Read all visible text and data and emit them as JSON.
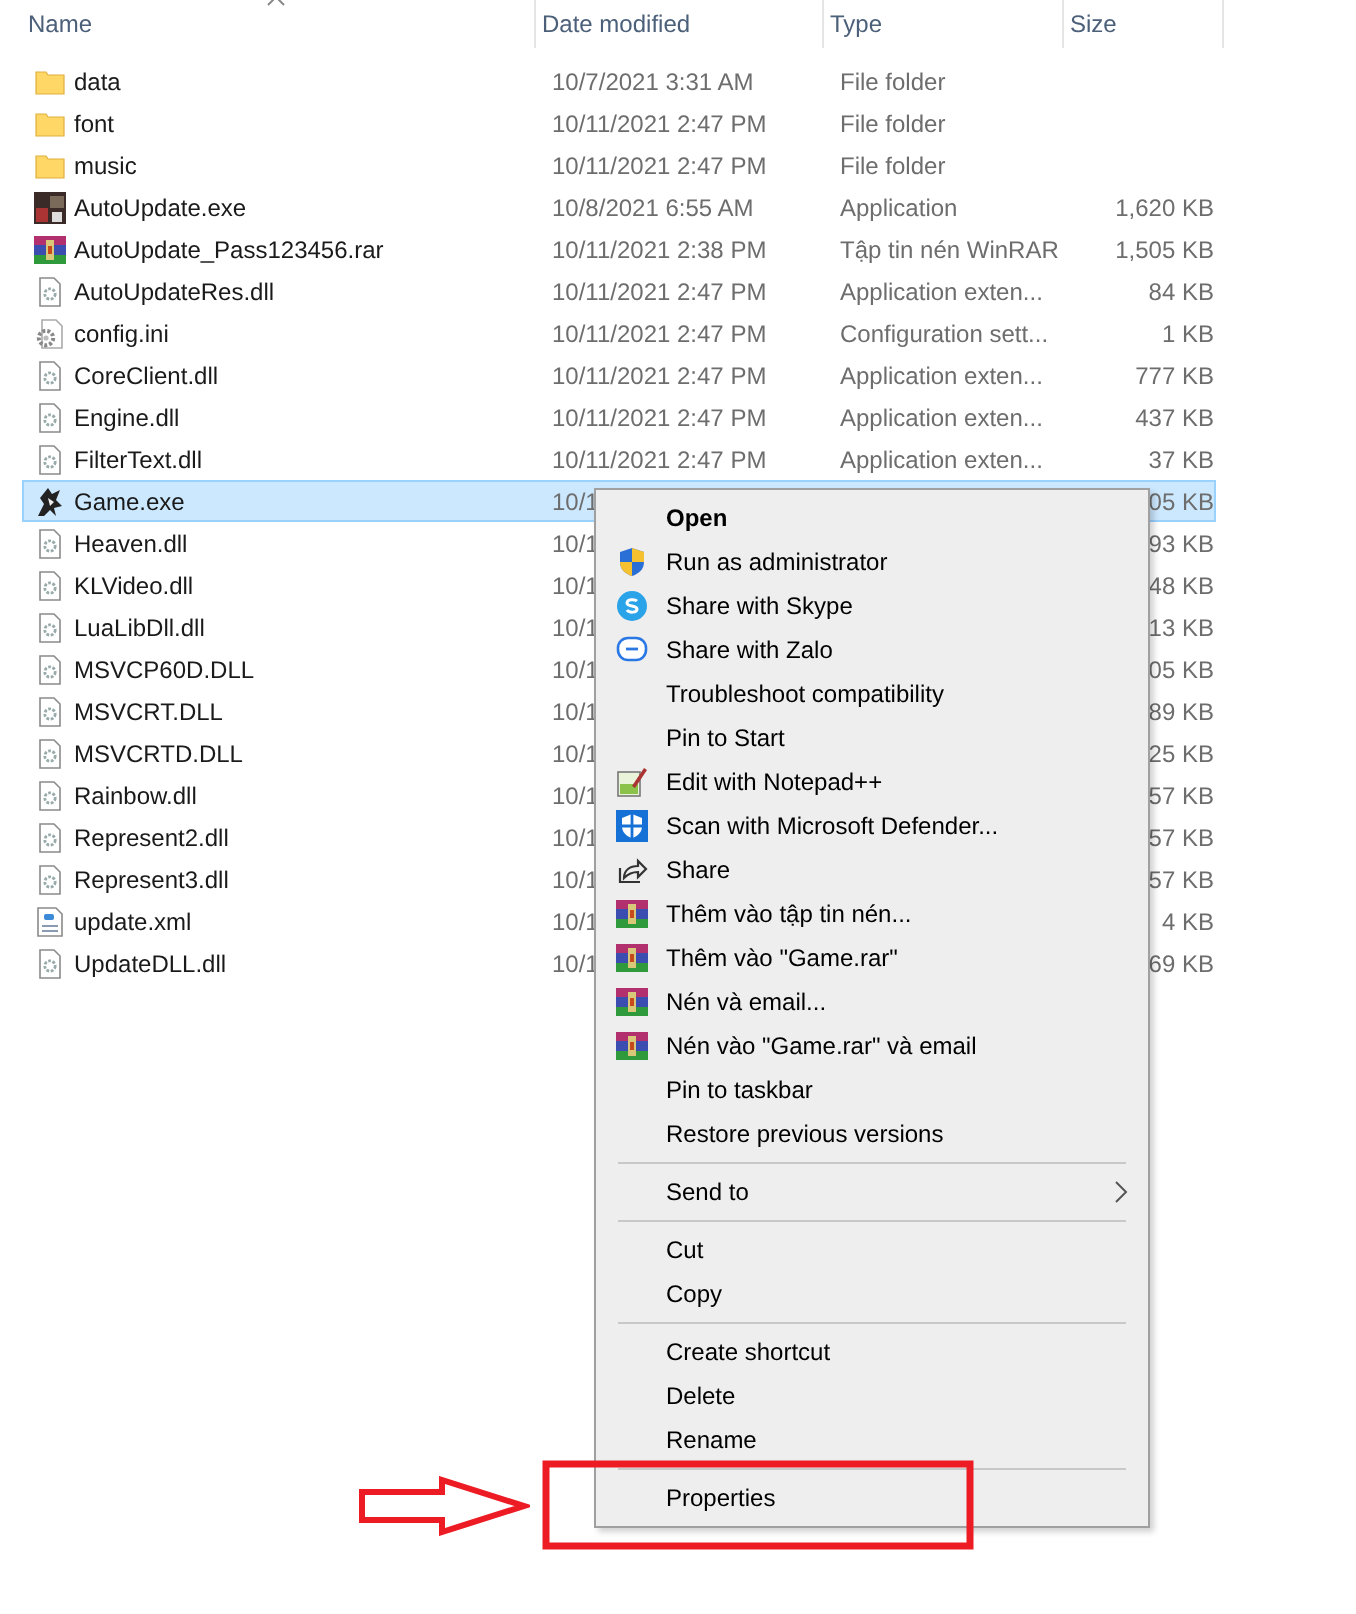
{
  "columns": [
    {
      "label": "Name",
      "sorted": true
    },
    {
      "label": "Date modified",
      "sorted": false
    },
    {
      "label": "Type",
      "sorted": false
    },
    {
      "label": "Size",
      "sorted": false
    }
  ],
  "files": [
    {
      "name": "data",
      "kind": "folder",
      "date": "10/7/2021 3:31 AM",
      "type": "File folder",
      "selected": false
    },
    {
      "name": "font",
      "kind": "folder",
      "date": "10/11/2021 2:47 PM",
      "type": "File folder",
      "selected": false
    },
    {
      "name": "music",
      "kind": "folder",
      "date": "10/11/2021 2:47 PM",
      "type": "File folder",
      "selected": false
    },
    {
      "name": "AutoUpdate.exe",
      "kind": "app",
      "date": "10/8/2021 6:55 AM",
      "type": "Application",
      "size": "1,620 KB",
      "selected": false
    },
    {
      "name": "AutoUpdate_Pass123456.rar",
      "kind": "archive",
      "date": "10/11/2021 2:38 PM",
      "type": "Tập tin nén WinRAR",
      "size": "1,505 KB",
      "selected": false
    },
    {
      "name": "AutoUpdateRes.dll",
      "kind": "dll",
      "date": "10/11/2021 2:47 PM",
      "type": "Application exten...",
      "size": "84 KB",
      "selected": false
    },
    {
      "name": "config.ini",
      "kind": "config",
      "date": "10/11/2021 2:47 PM",
      "type": "Configuration sett...",
      "size": "1 KB",
      "selected": false
    },
    {
      "name": "CoreClient.dll",
      "kind": "dll",
      "date": "10/11/2021 2:47 PM",
      "type": "Application exten...",
      "size": "777 KB",
      "selected": false
    },
    {
      "name": "Engine.dll",
      "kind": "dll",
      "date": "10/11/2021 2:47 PM",
      "type": "Application exten...",
      "size": "437 KB",
      "selected": false
    },
    {
      "name": "FilterText.dll",
      "kind": "dll",
      "date": "10/11/2021 2:47 PM",
      "type": "Application exten...",
      "size": "37 KB",
      "selected": false
    },
    {
      "name": "Game.exe",
      "kind": "game",
      "date": "10/1",
      "size": "05 KB",
      "selected": true
    },
    {
      "name": "Heaven.dll",
      "kind": "dll",
      "date": "10/1",
      "size": "93 KB",
      "selected": false
    },
    {
      "name": "KLVideo.dll",
      "kind": "dll",
      "date": "10/1",
      "size": "48 KB",
      "selected": false
    },
    {
      "name": "LuaLibDll.dll",
      "kind": "dll",
      "date": "10/1",
      "size": "13 KB",
      "selected": false
    },
    {
      "name": "MSVCP60D.DLL",
      "kind": "dll",
      "date": "10/1",
      "size": "05 KB",
      "selected": false
    },
    {
      "name": "MSVCRT.DLL",
      "kind": "dll",
      "date": "10/1",
      "size": "89 KB",
      "selected": false
    },
    {
      "name": "MSVCRTD.DLL",
      "kind": "dll",
      "date": "10/1",
      "size": "25 KB",
      "selected": false
    },
    {
      "name": "Rainbow.dll",
      "kind": "dll",
      "date": "10/1",
      "size": "57 KB",
      "selected": false
    },
    {
      "name": "Represent2.dll",
      "kind": "dll",
      "date": "10/1",
      "size": "57 KB",
      "selected": false
    },
    {
      "name": "Represent3.dll",
      "kind": "dll",
      "date": "10/1",
      "size": "57 KB",
      "selected": false
    },
    {
      "name": "update.xml",
      "kind": "xml",
      "date": "10/1",
      "size": "4 KB",
      "selected": false
    },
    {
      "name": "UpdateDLL.dll",
      "kind": "dll",
      "date": "10/1",
      "size": "69 KB",
      "selected": false
    }
  ],
  "context_menu": [
    {
      "kind": "plain",
      "label": "Open",
      "default": true,
      "submenu": false
    },
    {
      "kind": "shield",
      "label": "Run as administrator",
      "default": false,
      "submenu": false
    },
    {
      "kind": "skype",
      "label": "Share with Skype",
      "default": false,
      "submenu": false
    },
    {
      "kind": "zalo",
      "label": "Share with Zalo",
      "default": false,
      "submenu": false
    },
    {
      "kind": "plain",
      "label": "Troubleshoot compatibility",
      "default": false,
      "submenu": false
    },
    {
      "kind": "plain",
      "label": "Pin to Start",
      "default": false,
      "submenu": false
    },
    {
      "kind": "notepad",
      "label": "Edit with Notepad++",
      "default": false,
      "submenu": false
    },
    {
      "kind": "defender",
      "label": "Scan with Microsoft Defender...",
      "default": false,
      "submenu": false
    },
    {
      "kind": "share",
      "label": "Share",
      "default": false,
      "submenu": false
    },
    {
      "kind": "archive",
      "label": "Thêm vào tập tin nén...",
      "default": false,
      "submenu": false
    },
    {
      "kind": "archive",
      "label": "Thêm vào \"Game.rar\"",
      "default": false,
      "submenu": false
    },
    {
      "kind": "archive",
      "label": "Nén và email...",
      "default": false,
      "submenu": false
    },
    {
      "kind": "archive",
      "label": "Nén vào \"Game.rar\" và email",
      "default": false,
      "submenu": false
    },
    {
      "kind": "plain",
      "label": "Pin to taskbar",
      "default": false,
      "submenu": false
    },
    {
      "kind": "plain",
      "label": "Restore previous versions",
      "default": false,
      "submenu": false
    },
    {
      "kind": "separator"
    },
    {
      "kind": "plain",
      "label": "Send to",
      "default": false,
      "submenu": true
    },
    {
      "kind": "separator"
    },
    {
      "kind": "plain",
      "label": "Cut",
      "default": false,
      "submenu": false
    },
    {
      "kind": "plain",
      "label": "Copy",
      "default": false,
      "submenu": false
    },
    {
      "kind": "separator"
    },
    {
      "kind": "plain",
      "label": "Create shortcut",
      "default": false,
      "submenu": false
    },
    {
      "kind": "plain",
      "label": "Delete",
      "default": false,
      "submenu": false
    },
    {
      "kind": "plain",
      "label": "Rename",
      "default": false,
      "submenu": false
    },
    {
      "kind": "separator"
    },
    {
      "kind": "plain",
      "label": "Properties",
      "default": false,
      "submenu": false
    }
  ]
}
